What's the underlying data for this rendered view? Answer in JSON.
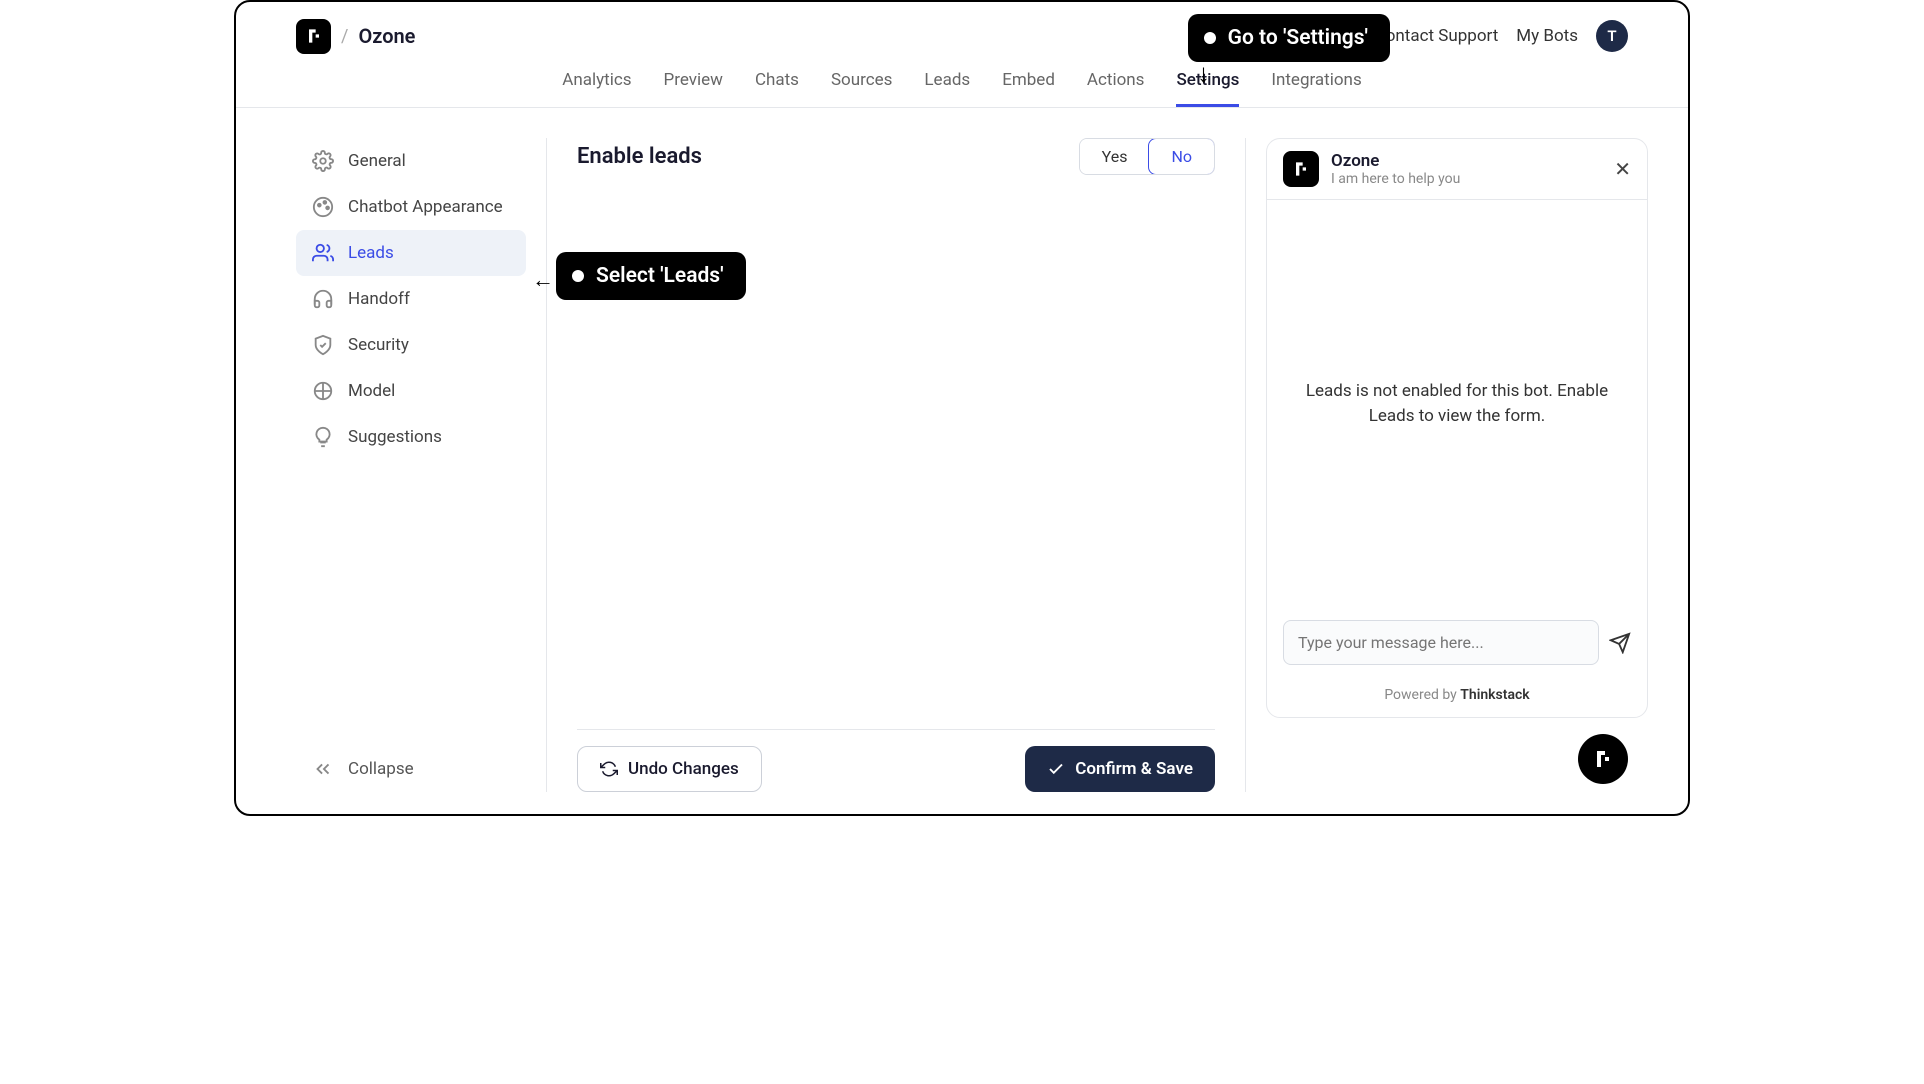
{
  "header": {
    "bot_name": "Ozone",
    "links": {
      "contact": "Contact Support",
      "mybots": "My Bots"
    },
    "avatar_initial": "T"
  },
  "nav": {
    "tabs": [
      "Analytics",
      "Preview",
      "Chats",
      "Sources",
      "Leads",
      "Embed",
      "Actions",
      "Settings",
      "Integrations"
    ],
    "active_index": 7
  },
  "sidebar": {
    "items": [
      {
        "label": "General"
      },
      {
        "label": "Chatbot Appearance"
      },
      {
        "label": "Leads"
      },
      {
        "label": "Handoff"
      },
      {
        "label": "Security"
      },
      {
        "label": "Model"
      },
      {
        "label": "Suggestions"
      }
    ],
    "active_index": 2,
    "collapse": "Collapse"
  },
  "content": {
    "title": "Enable leads",
    "toggle_yes": "Yes",
    "toggle_no": "No",
    "undo": "Undo Changes",
    "confirm": "Confirm & Save"
  },
  "chat": {
    "name": "Ozone",
    "sub": "I am here to help you",
    "empty": "Leads is not enabled for this bot. Enable Leads to view the form.",
    "placeholder": "Type your message here...",
    "powered_prefix": "Powered by ",
    "powered_brand": "Thinkstack"
  },
  "callouts": {
    "settings": "Go to 'Settings'",
    "leads": "Select 'Leads'"
  }
}
